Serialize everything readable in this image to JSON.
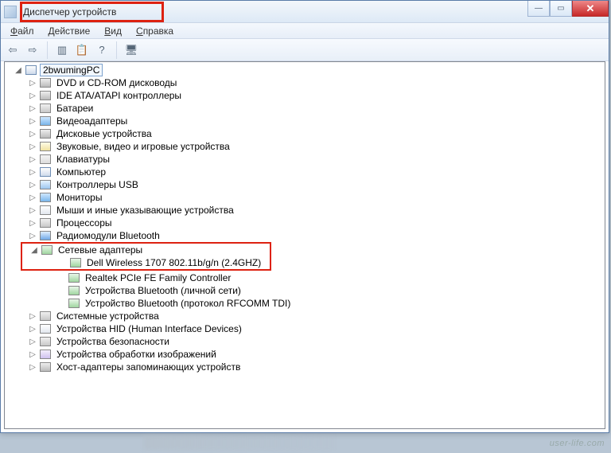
{
  "title": "Диспетчер устройств",
  "title_blur": "",
  "menu": {
    "file": "Файл",
    "action": "Действие",
    "view": "Вид",
    "help": "Справка"
  },
  "toolbar": {
    "back": "⇦",
    "forward": "⇨",
    "show_hidden": "▥",
    "properties": "📋",
    "help": "?",
    "scan": "🖥"
  },
  "root": "2bwumingPC",
  "nodes": [
    {
      "id": "dvd",
      "icon": "disk",
      "label": "DVD и CD-ROM дисководы"
    },
    {
      "id": "ide",
      "icon": "disk",
      "label": "IDE ATA/ATAPI контроллеры"
    },
    {
      "id": "bat",
      "icon": "cpu",
      "label": "Батареи"
    },
    {
      "id": "video",
      "icon": "monitor",
      "label": "Видеоадаптеры"
    },
    {
      "id": "diskdrv",
      "icon": "disk",
      "label": "Дисковые устройства"
    },
    {
      "id": "sound",
      "icon": "sound",
      "label": "Звуковые, видео и игровые устройства"
    },
    {
      "id": "kb",
      "icon": "kb",
      "label": "Клавиатуры"
    },
    {
      "id": "comp",
      "icon": "pc",
      "label": "Компьютер"
    },
    {
      "id": "usb",
      "icon": "usb",
      "label": "Контроллеры USB"
    },
    {
      "id": "mon",
      "icon": "monitor",
      "label": "Мониторы"
    },
    {
      "id": "mouse",
      "icon": "hid",
      "label": "Мыши и иные указывающие устройства"
    },
    {
      "id": "cpu",
      "icon": "cpu",
      "label": "Процессоры"
    },
    {
      "id": "btradio",
      "icon": "bt",
      "label": "Радиомодули Bluetooth"
    }
  ],
  "net_group": {
    "label": "Сетевые адаптеры",
    "children": [
      {
        "id": "wifi",
        "label": "Dell Wireless 1707 802.11b/g/n (2.4GHZ)",
        "highlighted": true
      },
      {
        "id": "realtek",
        "label": "Realtek PCIe FE Family Controller"
      },
      {
        "id": "btpan",
        "label": "Устройства Bluetooth (личной сети)"
      },
      {
        "id": "btrf",
        "label": "Устройство Bluetooth (протокол RFCOMM TDI)"
      }
    ]
  },
  "nodes_after": [
    {
      "id": "sys",
      "icon": "cpu",
      "label": "Системные устройства"
    },
    {
      "id": "hid",
      "icon": "hid",
      "label": "Устройства HID (Human Interface Devices)"
    },
    {
      "id": "sec",
      "icon": "cpu",
      "label": "Устройства безопасности"
    },
    {
      "id": "imgdev",
      "icon": "img",
      "label": "Устройства обработки изображений"
    },
    {
      "id": "host",
      "icon": "disk",
      "label": "Хост-адаптеры запоминающих устройств"
    }
  ],
  "watermark": "user-life.com"
}
